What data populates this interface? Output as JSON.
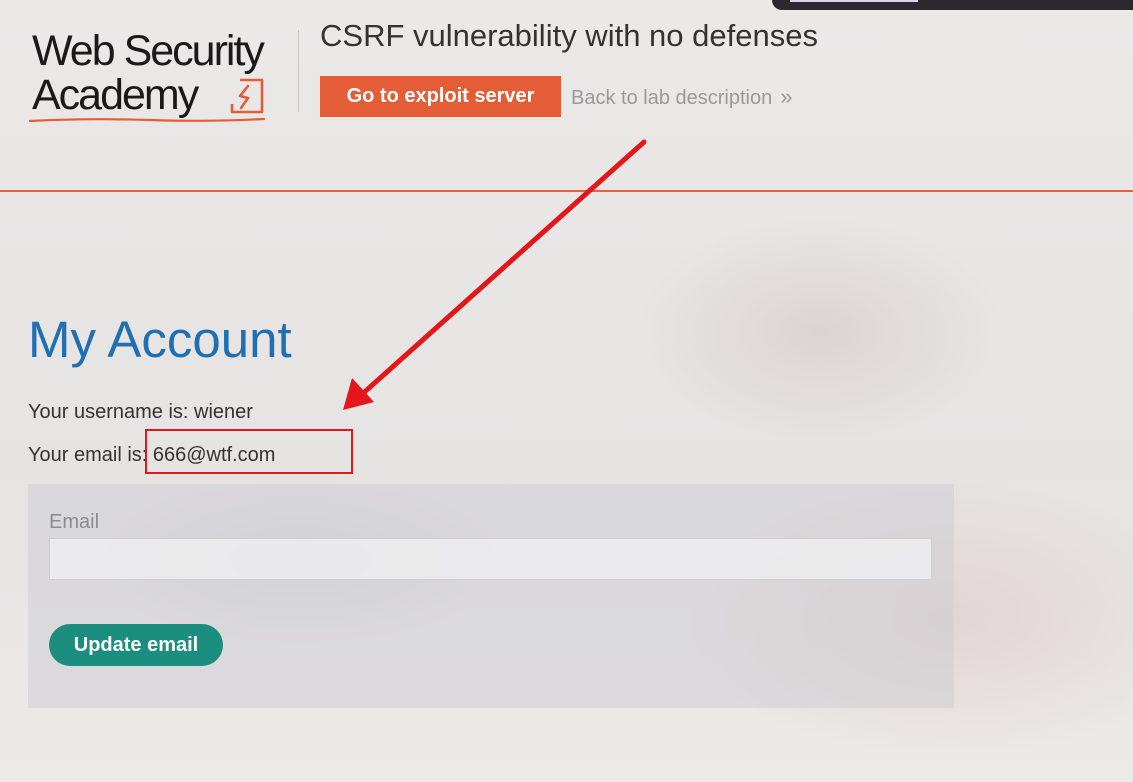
{
  "header": {
    "logo_text_line1": "Web Security",
    "logo_text_line2": "Academy",
    "lab_title": "CSRF vulnerability with no defenses",
    "exploit_button_label": "Go to exploit server",
    "back_link_label": "Back to lab description",
    "back_link_icon": "double-chevron-right-icon"
  },
  "main": {
    "page_title": "My Account",
    "username_prefix": "Your username is: ",
    "username": "wiener",
    "email_prefix": "Your email is: ",
    "email": "666@wtf.com",
    "form": {
      "email_label": "Email",
      "email_value": "",
      "update_button_label": "Update email"
    }
  },
  "annotations": {
    "arrow_color": "#e3161a",
    "highlight_color": "#e3161a"
  },
  "colors": {
    "accent_orange": "#e45d37",
    "title_blue": "#1f6fb3",
    "button_teal": "#1b8e7f"
  }
}
